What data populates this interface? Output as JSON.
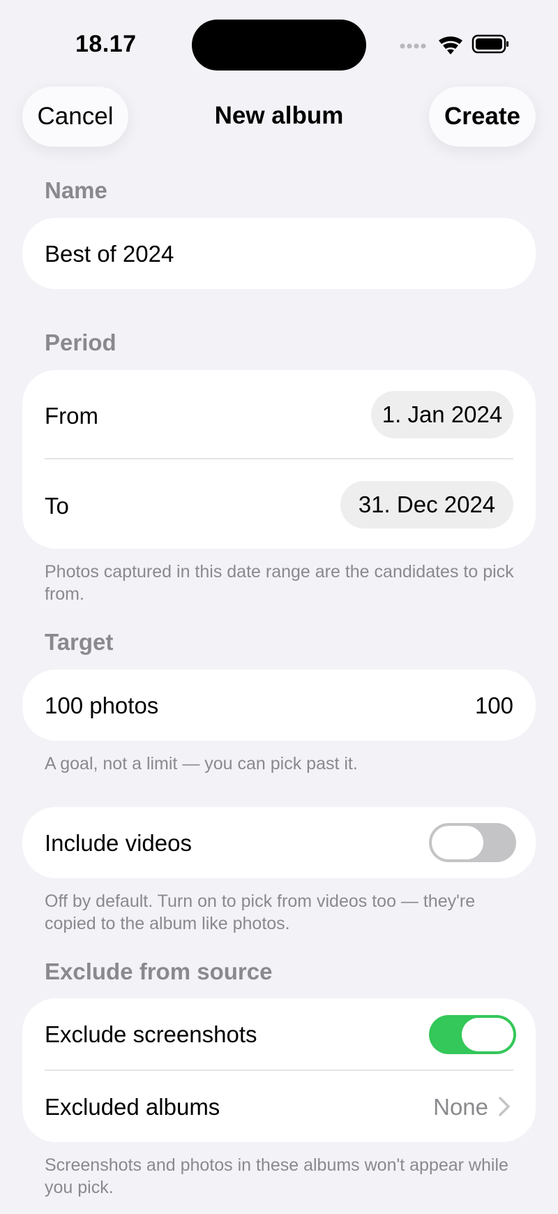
{
  "status_bar": {
    "time": "18.17",
    "icons": [
      "cellular-dots-icon",
      "wifi-icon",
      "battery-icon"
    ]
  },
  "nav": {
    "cancel_label": "Cancel",
    "title": "New album",
    "create_label": "Create"
  },
  "name_section": {
    "header": "Name",
    "value": "Best of 2024"
  },
  "period_section": {
    "header": "Period",
    "from_label": "From",
    "from_value": "1. Jan 2024",
    "to_label": "To",
    "to_value": "31. Dec 2024",
    "footnote": "Photos captured in this date range are the candidates to pick from."
  },
  "target_section": {
    "header": "Target",
    "label": "100 photos",
    "value": "100",
    "footnote": "A goal, not a limit — you can pick past it."
  },
  "videos_section": {
    "label": "Include videos",
    "enabled": false,
    "footnote": "Off by default. Turn on to pick from videos too — they're copied to the album like photos."
  },
  "exclude_section": {
    "header": "Exclude from source",
    "screenshots_label": "Exclude screenshots",
    "screenshots_enabled": true,
    "albums_label": "Excluded albums",
    "albums_value": "None",
    "footnote": "Screenshots and photos in these albums won't appear while you pick."
  },
  "colors": {
    "background": "#f2f2f7",
    "toggle_on": "#34c759",
    "toggle_off": "#c4c4c6",
    "secondary_text": "#8a8a8e"
  }
}
